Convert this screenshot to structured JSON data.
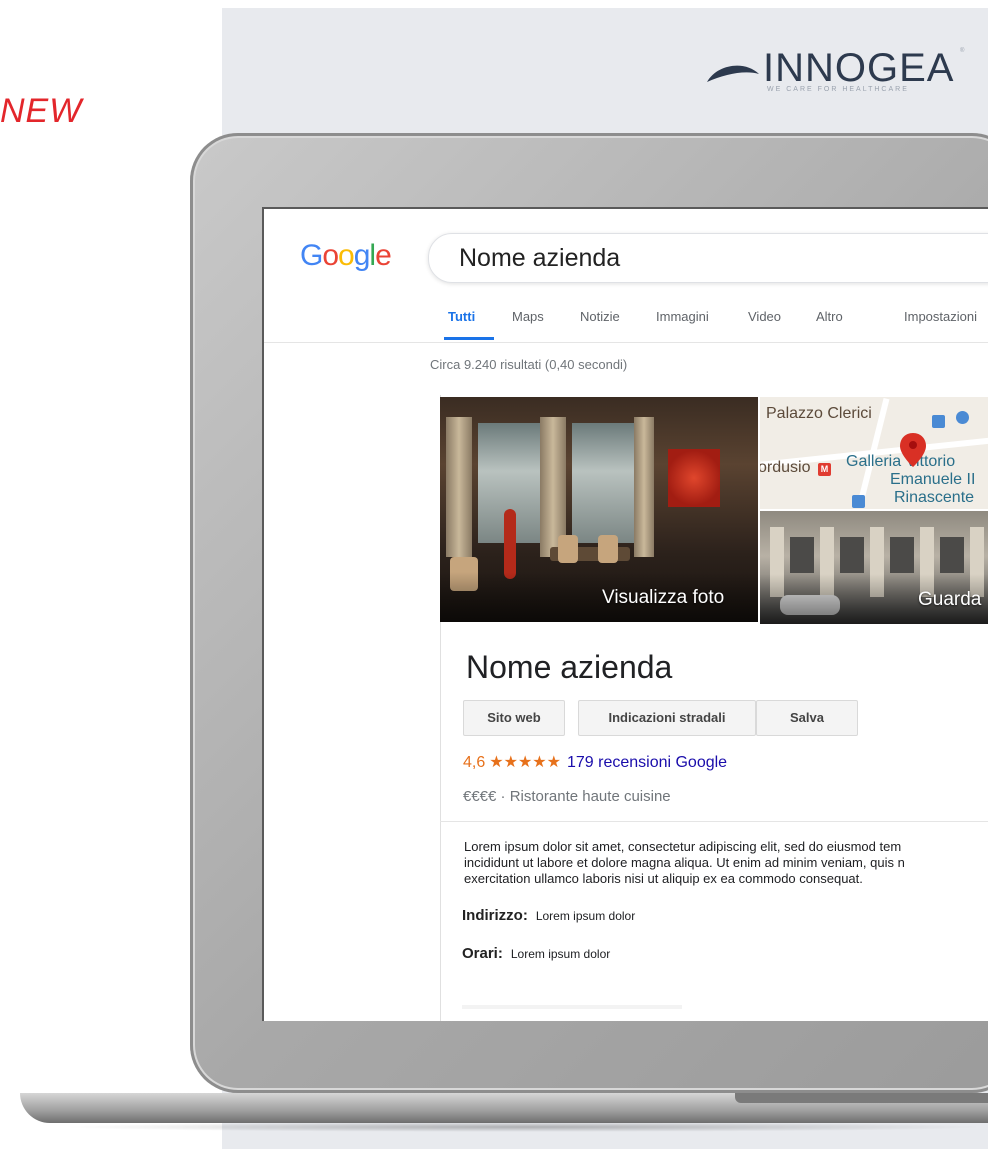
{
  "badge": {
    "new": "NEW"
  },
  "brand": {
    "name": "INNOGEA",
    "tagline": "WE CARE FOR HEALTHCARE",
    "registered": "®"
  },
  "google": {
    "logo_letters": [
      "G",
      "o",
      "o",
      "g",
      "l",
      "e"
    ],
    "logo_colors": [
      "#4285F4",
      "#EA4335",
      "#FBBC05",
      "#4285F4",
      "#34A853",
      "#EA4335"
    ],
    "query": "Nome azienda",
    "tabs": [
      "Tutti",
      "Maps",
      "Notizie",
      "Immagini",
      "Video",
      "Altro",
      "Impostazioni"
    ],
    "active_tab": "Tutti",
    "result_stats": "Circa 9.240 risultati (0,40 secondi)"
  },
  "knowledge_panel": {
    "photo_caption": "Visualizza foto",
    "street_caption": "Guarda",
    "map_labels": {
      "palazzo": "Palazzo Clerici",
      "cordusio": "ordusio",
      "metro": "M",
      "galleria": "Galleria Vittorio",
      "emanuele": "Emanuele II",
      "rinascente": "Rinascente"
    },
    "title": "Nome azienda",
    "buttons": [
      "Sito web",
      "Indicazioni stradali",
      "Salva"
    ],
    "rating_value": "4,6",
    "rating_stars": "★★★★★",
    "reviews": "179 recensioni Google",
    "price": "€€€€",
    "category": "Ristorante haute cuisine",
    "separator": "·",
    "description": "Lorem ipsum dolor sit amet, consectetur adipiscing elit, sed do eiusmod tem\nincididunt ut labore et dolore magna aliqua. Ut enim ad minim veniam, quis n\nexercitation ullamco laboris nisi ut aliquip ex ea commodo consequat.",
    "address_label": "Indirizzo:",
    "address_value": "Lorem ipsum dolor",
    "hours_label": "Orari:",
    "hours_value": "Lorem ipsum dolor"
  }
}
